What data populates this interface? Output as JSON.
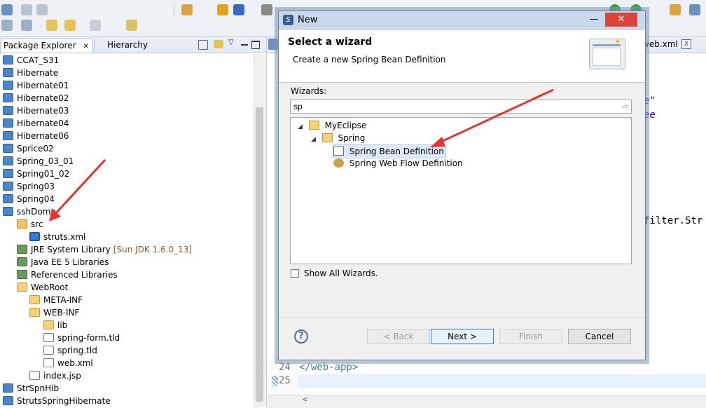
{
  "left_view": {
    "tabs": [
      {
        "label": "Package Explorer",
        "close": "✕"
      },
      {
        "label": "Hierarchy"
      }
    ],
    "tree": [
      {
        "label": "CCAT_S31",
        "icon": "project-icon",
        "decor": ""
      },
      {
        "label": "Hibernate",
        "icon": "project-icon",
        "decor": ""
      },
      {
        "label": "Hibernate01",
        "icon": "project-icon",
        "decor": ""
      },
      {
        "label": "Hibernate02",
        "icon": "project-icon",
        "decor": ""
      },
      {
        "label": "Hibernate03",
        "icon": "project-icon",
        "decor": ""
      },
      {
        "label": "Hibernate04",
        "icon": "project-icon",
        "decor": ""
      },
      {
        "label": "Hibernate06",
        "icon": "project-icon",
        "decor": ""
      },
      {
        "label": "Sprice02",
        "icon": "project-icon",
        "decor": ""
      },
      {
        "label": "Spring_03_01",
        "icon": "project-icon",
        "decor": ""
      },
      {
        "label": "Spring01_02",
        "icon": "project-icon",
        "decor": ""
      },
      {
        "label": "Spring03",
        "icon": "project-icon",
        "decor": ""
      },
      {
        "label": "Spring04",
        "icon": "project-icon",
        "decor": ""
      },
      {
        "label": "sshDome",
        "icon": "project-icon",
        "decor": ""
      },
      {
        "label": "src",
        "icon": "source-folder-icon",
        "decor": ""
      },
      {
        "label": "struts.xml",
        "icon": "gear-icon",
        "decor": ""
      },
      {
        "label": "JRE System Library",
        "icon": "library-icon",
        "decor": "[Sun JDK 1.6.0_13]"
      },
      {
        "label": "Java EE 5 Libraries",
        "icon": "library-icon",
        "decor": ""
      },
      {
        "label": "Referenced Libraries",
        "icon": "library-icon",
        "decor": ""
      },
      {
        "label": "WebRoot",
        "icon": "folder-icon",
        "decor": ""
      },
      {
        "label": "META-INF",
        "icon": "folder-icon",
        "decor": ""
      },
      {
        "label": "WEB-INF",
        "icon": "folder-icon",
        "decor": ""
      },
      {
        "label": "lib",
        "icon": "folder-icon",
        "decor": ""
      },
      {
        "label": "spring-form.tld",
        "icon": "file-icon",
        "decor": ""
      },
      {
        "label": "spring.tld",
        "icon": "file-icon",
        "decor": ""
      },
      {
        "label": "web.xml",
        "icon": "xml-file-icon",
        "decor": ""
      },
      {
        "label": "index.jsp",
        "icon": "jsp-file-icon",
        "decor": ""
      },
      {
        "label": "StrSpnHib",
        "icon": "project-icon",
        "decor": ""
      },
      {
        "label": "StrutsSpringHibernate",
        "icon": "project-icon",
        "decor": ""
      }
    ]
  },
  "editor": {
    "tab_label": "web.xml",
    "fragments": [
      "e\"",
      "ee",
      "filter.Str"
    ],
    "lines": [
      {
        "num": "24",
        "text": "</web-app>"
      },
      {
        "num": "25",
        "text": ""
      }
    ]
  },
  "dialog": {
    "title": "New",
    "header_title": "Select a wizard",
    "header_description": "Create a new Spring Bean Definition",
    "wizards_label": "Wizards:",
    "filter_value": "sp",
    "tree": [
      {
        "label": "MyEclipse",
        "twisty": "◢",
        "icon": "folder-open-icon"
      },
      {
        "label": "Spring",
        "twisty": "◢",
        "icon": "folder-open-icon"
      },
      {
        "label": "Spring Bean Definition",
        "icon": "spring-bean-icon",
        "selected": true
      },
      {
        "label": "Spring Web Flow Definition",
        "icon": "web-flow-icon"
      }
    ],
    "show_all_label": "Show All Wizards.",
    "show_all_checked": false,
    "buttons": {
      "back": "< Back",
      "next": "Next >",
      "finish": "Finish",
      "cancel": "Cancel"
    },
    "help_symbol": "?",
    "close_symbol": "✕",
    "minimize_symbol": "—"
  },
  "colors": {
    "arrow": "#e8322f",
    "close_button": "#d9453a",
    "selection": "#dbe9f9"
  }
}
